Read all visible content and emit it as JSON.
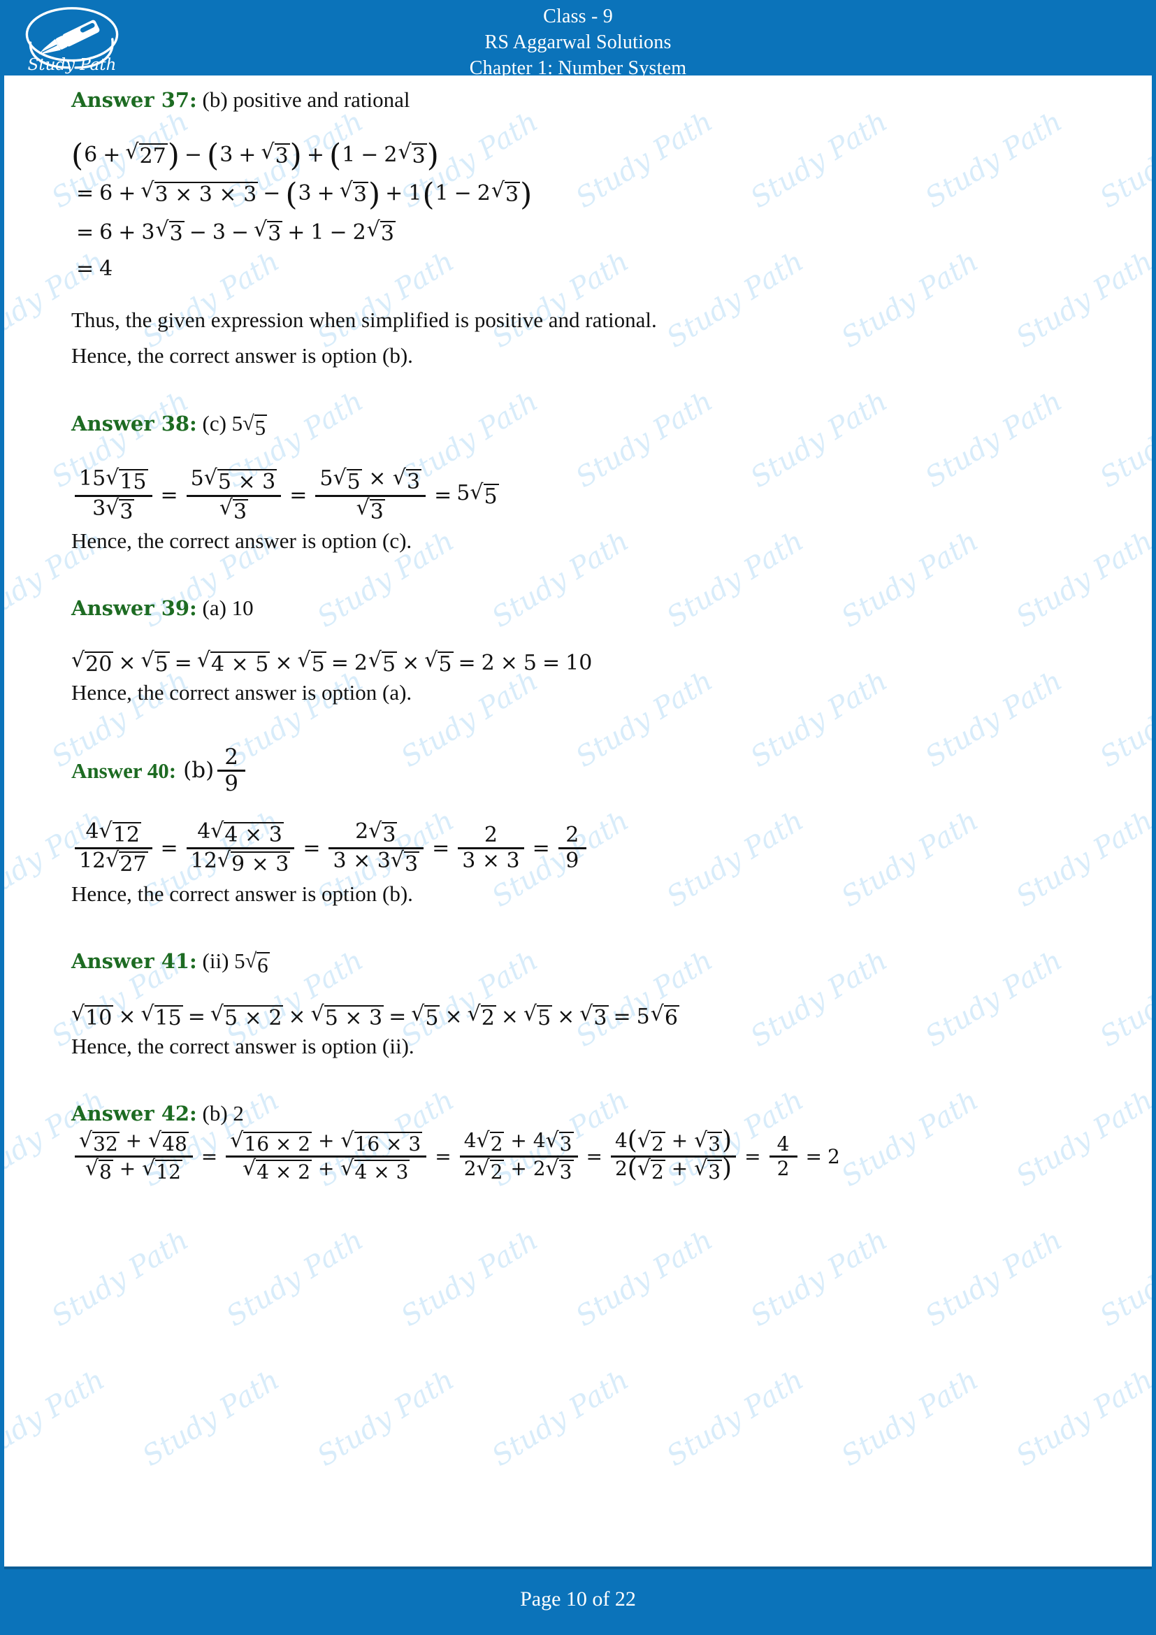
{
  "header": {
    "line1": "Class - 9",
    "line2": "RS Aggarwal Solutions",
    "line3": "Chapter 1: Number System",
    "logo_text": "Study Path",
    "bg_color": "#0b73ba"
  },
  "footer": {
    "text": "Page 10 of 22",
    "page_number": "10",
    "total_pages": "22",
    "bg_color": "#0b73ba"
  },
  "watermark": {
    "text": "Study Path",
    "color": "#d6ecfa"
  },
  "colors": {
    "answer_label": "#1d6b22",
    "body_text": "#111111",
    "accent": "#0b73ba"
  },
  "answers": [
    {
      "label": "Answer 37:",
      "option": "(b) positive and rational",
      "lines": [
        "(6 + √27) − (3 + √3) + (1 − 2√3)",
        "= 6 + √(3 × 3 × 3) − (3 + √3) + 1(1 − 2√3)",
        "= 6 + 3√3 − 3 − √3 + 1 − 2√3",
        "= 4"
      ],
      "prose": [
        "Thus, the given expression when simplified is positive and rational.",
        "Hence, the correct answer is option (b)."
      ]
    },
    {
      "label": "Answer 38:",
      "option": "(c) 5√5",
      "lines": [
        "15√15 / 3√3 = 5√(5 × 3) / √3 = 5√5 × √3 / √3 = 5√5"
      ],
      "prose": [
        "Hence, the correct answer is option (c)."
      ]
    },
    {
      "label": "Answer 39:",
      "option": "(a) 10",
      "lines": [
        "√20 × √5 = √(4 × 5) × √5 = 2√5 × √5 = 2 × 5 = 10"
      ],
      "prose": [
        "Hence, the correct answer is option (a)."
      ]
    },
    {
      "label": "Answer 40:",
      "option": "(b) 2/9",
      "lines": [
        "4√12 / 12√27 = 4√(4 × 3) / 12√(9 × 3) = 2√3 / (3 × 3√3) = 2 / (3 × 3) = 2/9"
      ],
      "prose": [
        "Hence, the correct answer is option (b)."
      ]
    },
    {
      "label": "Answer 41:",
      "option": "(ii) 5√6",
      "lines": [
        "√10 × √15 = √(5 × 2) × √(5 × 3) = √5 × √2 × √5 × √3 = 5√6"
      ],
      "prose": [
        "Hence, the correct answer is option (ii)."
      ]
    },
    {
      "label": "Answer 42:",
      "option": "(b) 2",
      "lines": [
        "(√32 + √48) / (√8 + √12) = (√(16 × 2) + √(16 × 3)) / (√(4 × 2) + √(4 × 3)) = (4√2 + 4√3) / (2√2 + 2√3) = 4(√2 + √3) / 2(√2 + √3) = 4/2 = 2"
      ],
      "prose": []
    }
  ],
  "tokens": {
    "eq": "=",
    "plus": "+",
    "minus": "−",
    "times": "×",
    "radical": "√",
    "lparen": "(",
    "rparen": ")",
    "n1": "1",
    "n2": "2",
    "n3": "3",
    "n4": "4",
    "n5": "5",
    "n6": "6",
    "n8": "8",
    "n9": "9",
    "n10": "10",
    "n12": "12",
    "n15": "15",
    "n16": "16",
    "n20": "20",
    "n27": "27",
    "n32": "32",
    "n48": "48"
  }
}
